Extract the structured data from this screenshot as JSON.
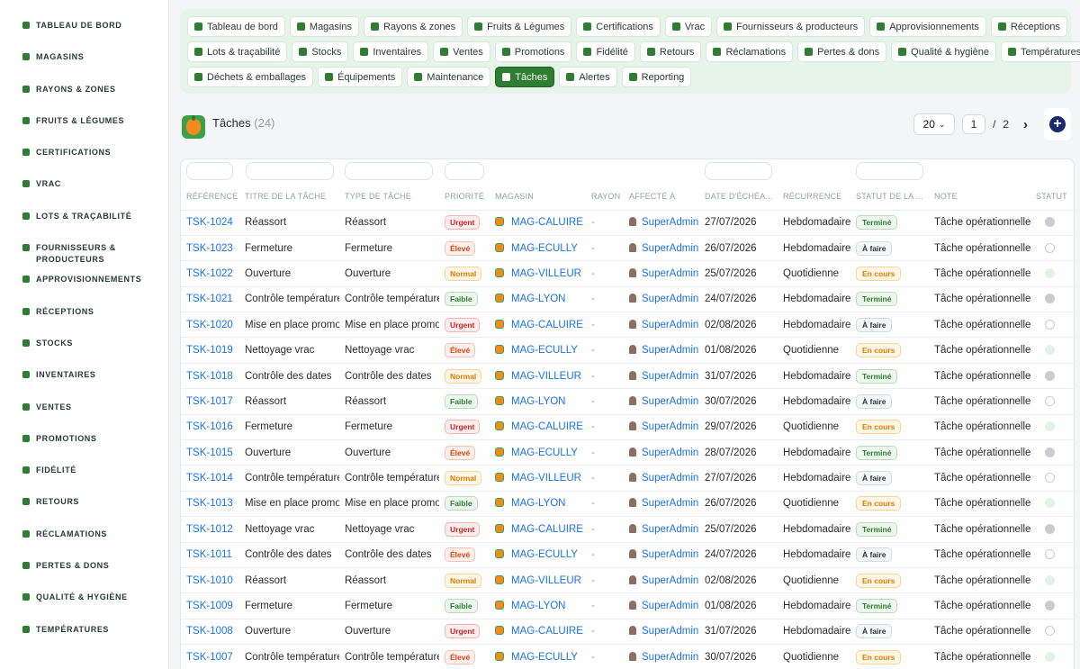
{
  "sidebar": {
    "items": [
      {
        "label": "Tableau de bord",
        "icon": "sprout-icon"
      },
      {
        "label": "Magasins",
        "icon": "store-icon"
      },
      {
        "label": "Rayons & zones",
        "icon": "grid-icon"
      },
      {
        "label": "Fruits & Légumes",
        "icon": "leaf-icon"
      },
      {
        "label": "Certifications",
        "icon": "badge-icon"
      },
      {
        "label": "Vrac",
        "icon": "scale-icon"
      },
      {
        "label": "Lots & traçabilité",
        "icon": "barcode-icon"
      },
      {
        "label": "Fournisseurs & producteurs",
        "icon": "tractor-icon"
      },
      {
        "label": "Approvisionnements",
        "icon": "supply-icon"
      },
      {
        "label": "Réceptions",
        "icon": "truck-icon"
      },
      {
        "label": "Stocks",
        "icon": "box-icon"
      },
      {
        "label": "Inventaires",
        "icon": "clipboard-icon"
      },
      {
        "label": "Ventes",
        "icon": "cart-icon"
      },
      {
        "label": "Promotions",
        "icon": "tag-icon"
      },
      {
        "label": "Fidélité",
        "icon": "award-icon"
      },
      {
        "label": "Retours",
        "icon": "return-icon"
      },
      {
        "label": "Réclamations",
        "icon": "chat-icon"
      },
      {
        "label": "Pertes & dons",
        "icon": "trash-icon"
      },
      {
        "label": "Qualité & hygiène",
        "icon": "quality-icon"
      },
      {
        "label": "Températures",
        "icon": "thermometer-icon"
      }
    ]
  },
  "nav": {
    "rows": [
      [
        {
          "label": "Tableau de bord",
          "icon": "sprout-icon"
        },
        {
          "label": "Magasins",
          "icon": "store-icon"
        },
        {
          "label": "Rayons & zones",
          "icon": "grid-icon"
        },
        {
          "label": "Fruits & Légumes",
          "icon": "leaf-icon"
        },
        {
          "label": "Certifications",
          "icon": "badge-icon"
        },
        {
          "label": "Vrac",
          "icon": "scale-icon"
        },
        {
          "label": "Fournisseurs & producteurs",
          "icon": "tractor-icon"
        },
        {
          "label": "Approvisionnements",
          "icon": "supply-icon"
        },
        {
          "label": "Réceptions",
          "icon": "truck-icon"
        }
      ],
      [
        {
          "label": "Lots & traçabilité",
          "icon": "barcode-icon"
        },
        {
          "label": "Stocks",
          "icon": "box-icon"
        },
        {
          "label": "Inventaires",
          "icon": "clipboard-icon"
        },
        {
          "label": "Ventes",
          "icon": "cart-icon"
        },
        {
          "label": "Promotions",
          "icon": "tag-icon"
        },
        {
          "label": "Fidélité",
          "icon": "award-icon"
        },
        {
          "label": "Retours",
          "icon": "return-icon"
        },
        {
          "label": "Réclamations",
          "icon": "chat-icon"
        },
        {
          "label": "Pertes & dons",
          "icon": "trash-icon"
        },
        {
          "label": "Qualité & hygiène",
          "icon": "quality-icon"
        },
        {
          "label": "Températures",
          "icon": "thermometer-icon"
        }
      ],
      [
        {
          "label": "Déchets & emballages",
          "icon": "recycle-icon"
        },
        {
          "label": "Équipements",
          "icon": "equipment-icon"
        },
        {
          "label": "Maintenance",
          "icon": "wrench-icon"
        },
        {
          "label": "Tâches",
          "icon": "tasks-icon",
          "active": true
        },
        {
          "label": "Alertes",
          "icon": "bell-icon"
        },
        {
          "label": "Reporting",
          "icon": "chart-icon"
        }
      ]
    ]
  },
  "header": {
    "title": "Tâches",
    "count": "(24)",
    "page_size": "20",
    "page": "1",
    "page_sep": "/",
    "total_pages": "2",
    "next_icon": "chevron-right-icon",
    "add_icon": "plus-circle-icon"
  },
  "table": {
    "columns": [
      "RÉFÉRENCE",
      "TITRE DE LA TÂCHE",
      "TYPE DE TÂCHE",
      "PRIORITÉ",
      "MAGASIN",
      "RAYON",
      "AFFECTÉ À",
      "DATE D'ÉCHÉA...",
      "RÉCURRENCE",
      "STATUT DE LA ...",
      "NOTE",
      "STATUT"
    ],
    "rows": [
      {
        "ref": "TSK-1024",
        "title": "Réassort",
        "type": "Réassort",
        "priority": "Urgent",
        "store": "MAG-CALUIRE",
        "rayon": "-",
        "assignee": "SuperAdmin",
        "due": "27/07/2026",
        "recurrence": "Hebdomadaire",
        "status": "Terminé",
        "note": "Tâche opérationnelle.",
        "dot": "full"
      },
      {
        "ref": "TSK-1023",
        "title": "Fermeture",
        "type": "Fermeture",
        "priority": "Élevé",
        "store": "MAG-ECULLY",
        "rayon": "-",
        "assignee": "SuperAdmin",
        "due": "26/07/2026",
        "recurrence": "Hebdomadaire",
        "status": "À faire",
        "note": "Tâche opérationnelle.",
        "dot": "empty"
      },
      {
        "ref": "TSK-1022",
        "title": "Ouverture",
        "type": "Ouverture",
        "priority": "Normal",
        "store": "MAG-VILLEUR",
        "rayon": "-",
        "assignee": "SuperAdmin",
        "due": "25/07/2026",
        "recurrence": "Quotidienne",
        "status": "En cours",
        "note": "Tâche opérationnelle.",
        "dot": "light"
      },
      {
        "ref": "TSK-1021",
        "title": "Contrôle température",
        "type": "Contrôle température",
        "priority": "Faible",
        "store": "MAG-LYON",
        "rayon": "-",
        "assignee": "SuperAdmin",
        "due": "24/07/2026",
        "recurrence": "Hebdomadaire",
        "status": "Terminé",
        "note": "Tâche opérationnelle.",
        "dot": "full"
      },
      {
        "ref": "TSK-1020",
        "title": "Mise en place promo",
        "type": "Mise en place promo",
        "priority": "Urgent",
        "store": "MAG-CALUIRE",
        "rayon": "-",
        "assignee": "SuperAdmin",
        "due": "02/08/2026",
        "recurrence": "Hebdomadaire",
        "status": "À faire",
        "note": "Tâche opérationnelle.",
        "dot": "empty"
      },
      {
        "ref": "TSK-1019",
        "title": "Nettoyage vrac",
        "type": "Nettoyage vrac",
        "priority": "Élevé",
        "store": "MAG-ECULLY",
        "rayon": "-",
        "assignee": "SuperAdmin",
        "due": "01/08/2026",
        "recurrence": "Quotidienne",
        "status": "En cours",
        "note": "Tâche opérationnelle.",
        "dot": "light"
      },
      {
        "ref": "TSK-1018",
        "title": "Contrôle des dates",
        "type": "Contrôle des dates",
        "priority": "Normal",
        "store": "MAG-VILLEUR",
        "rayon": "-",
        "assignee": "SuperAdmin",
        "due": "31/07/2026",
        "recurrence": "Hebdomadaire",
        "status": "Terminé",
        "note": "Tâche opérationnelle.",
        "dot": "full"
      },
      {
        "ref": "TSK-1017",
        "title": "Réassort",
        "type": "Réassort",
        "priority": "Faible",
        "store": "MAG-LYON",
        "rayon": "-",
        "assignee": "SuperAdmin",
        "due": "30/07/2026",
        "recurrence": "Hebdomadaire",
        "status": "À faire",
        "note": "Tâche opérationnelle.",
        "dot": "empty"
      },
      {
        "ref": "TSK-1016",
        "title": "Fermeture",
        "type": "Fermeture",
        "priority": "Urgent",
        "store": "MAG-CALUIRE",
        "rayon": "-",
        "assignee": "SuperAdmin",
        "due": "29/07/2026",
        "recurrence": "Quotidienne",
        "status": "En cours",
        "note": "Tâche opérationnelle.",
        "dot": "light"
      },
      {
        "ref": "TSK-1015",
        "title": "Ouverture",
        "type": "Ouverture",
        "priority": "Élevé",
        "store": "MAG-ECULLY",
        "rayon": "-",
        "assignee": "SuperAdmin",
        "due": "28/07/2026",
        "recurrence": "Hebdomadaire",
        "status": "Terminé",
        "note": "Tâche opérationnelle.",
        "dot": "full"
      },
      {
        "ref": "TSK-1014",
        "title": "Contrôle température",
        "type": "Contrôle température",
        "priority": "Normal",
        "store": "MAG-VILLEUR",
        "rayon": "-",
        "assignee": "SuperAdmin",
        "due": "27/07/2026",
        "recurrence": "Hebdomadaire",
        "status": "À faire",
        "note": "Tâche opérationnelle.",
        "dot": "empty"
      },
      {
        "ref": "TSK-1013",
        "title": "Mise en place promo",
        "type": "Mise en place promo",
        "priority": "Faible",
        "store": "MAG-LYON",
        "rayon": "-",
        "assignee": "SuperAdmin",
        "due": "26/07/2026",
        "recurrence": "Quotidienne",
        "status": "En cours",
        "note": "Tâche opérationnelle.",
        "dot": "light"
      },
      {
        "ref": "TSK-1012",
        "title": "Nettoyage vrac",
        "type": "Nettoyage vrac",
        "priority": "Urgent",
        "store": "MAG-CALUIRE",
        "rayon": "-",
        "assignee": "SuperAdmin",
        "due": "25/07/2026",
        "recurrence": "Hebdomadaire",
        "status": "Terminé",
        "note": "Tâche opérationnelle.",
        "dot": "full"
      },
      {
        "ref": "TSK-1011",
        "title": "Contrôle des dates",
        "type": "Contrôle des dates",
        "priority": "Élevé",
        "store": "MAG-ECULLY",
        "rayon": "-",
        "assignee": "SuperAdmin",
        "due": "24/07/2026",
        "recurrence": "Hebdomadaire",
        "status": "À faire",
        "note": "Tâche opérationnelle.",
        "dot": "empty"
      },
      {
        "ref": "TSK-1010",
        "title": "Réassort",
        "type": "Réassort",
        "priority": "Normal",
        "store": "MAG-VILLEUR",
        "rayon": "-",
        "assignee": "SuperAdmin",
        "due": "02/08/2026",
        "recurrence": "Quotidienne",
        "status": "En cours",
        "note": "Tâche opérationnelle.",
        "dot": "light"
      },
      {
        "ref": "TSK-1009",
        "title": "Fermeture",
        "type": "Fermeture",
        "priority": "Faible",
        "store": "MAG-LYON",
        "rayon": "-",
        "assignee": "SuperAdmin",
        "due": "01/08/2026",
        "recurrence": "Hebdomadaire",
        "status": "Terminé",
        "note": "Tâche opérationnelle.",
        "dot": "full"
      },
      {
        "ref": "TSK-1008",
        "title": "Ouverture",
        "type": "Ouverture",
        "priority": "Urgent",
        "store": "MAG-CALUIRE",
        "rayon": "-",
        "assignee": "SuperAdmin",
        "due": "31/07/2026",
        "recurrence": "Hebdomadaire",
        "status": "À faire",
        "note": "Tâche opérationnelle.",
        "dot": "empty"
      },
      {
        "ref": "TSK-1007",
        "title": "Contrôle température",
        "type": "Contrôle température",
        "priority": "Élevé",
        "store": "MAG-ECULLY",
        "rayon": "-",
        "assignee": "SuperAdmin",
        "due": "30/07/2026",
        "recurrence": "Quotidienne",
        "status": "En cours",
        "note": "Tâche opérationnelle.",
        "dot": "light"
      }
    ]
  }
}
